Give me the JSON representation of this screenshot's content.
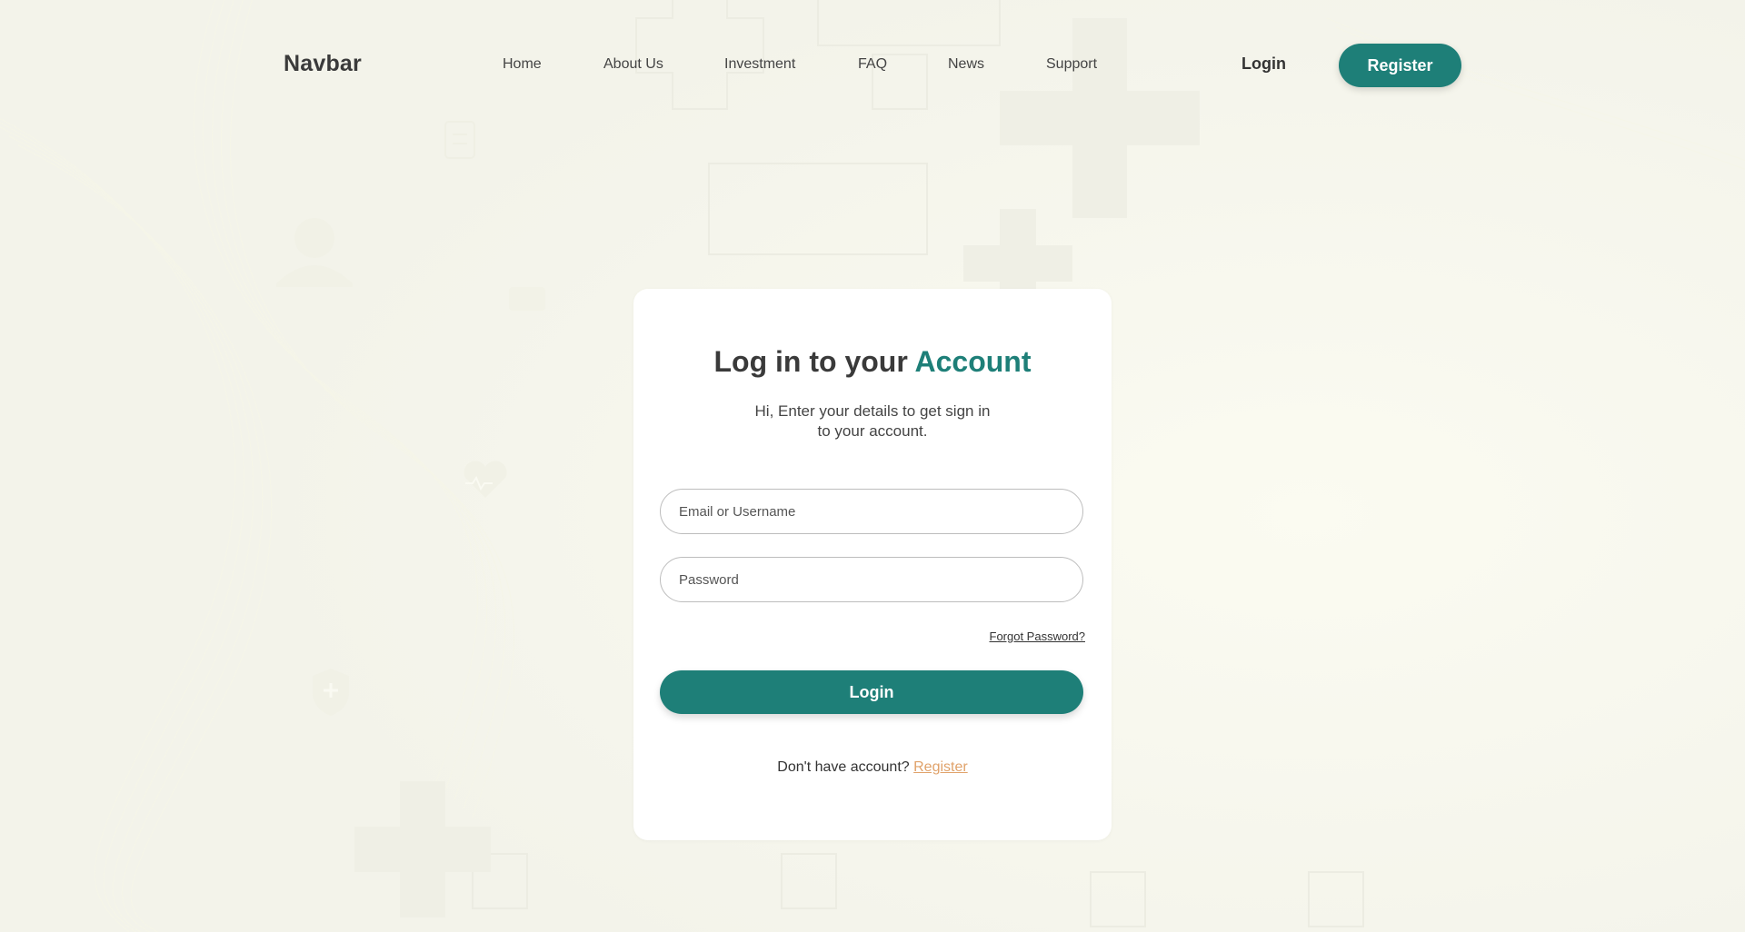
{
  "navbar": {
    "brand": "Navbar",
    "links": [
      {
        "label": "Home"
      },
      {
        "label": "About Us"
      },
      {
        "label": "Investment"
      },
      {
        "label": "FAQ"
      },
      {
        "label": "News"
      },
      {
        "label": "Support"
      }
    ],
    "login_label": "Login",
    "register_label": "Register"
  },
  "login_card": {
    "title_prefix": "Log in to your",
    "title_accent": "Account",
    "subtitle_line1": "Hi, Enter your details to get sign in",
    "subtitle_line2": "to your account.",
    "email_placeholder": "Email or Username",
    "email_value": "",
    "password_placeholder": "Password",
    "password_value": "",
    "forgot_label": "Forgot Password?",
    "login_button_label": "Login",
    "no_account_text": "Don't have account?",
    "register_link_label": "Register"
  },
  "colors": {
    "accent": "#1e7f78",
    "background": "#f7f7ef",
    "link_orange": "#e0a26a",
    "card": "#ffffff"
  },
  "icons": [
    "doctor-icon",
    "heart-pulse-icon",
    "clipboard-icon",
    "shield-plus-icon",
    "medical-cross-icon",
    "first-aid-kit-icon"
  ]
}
